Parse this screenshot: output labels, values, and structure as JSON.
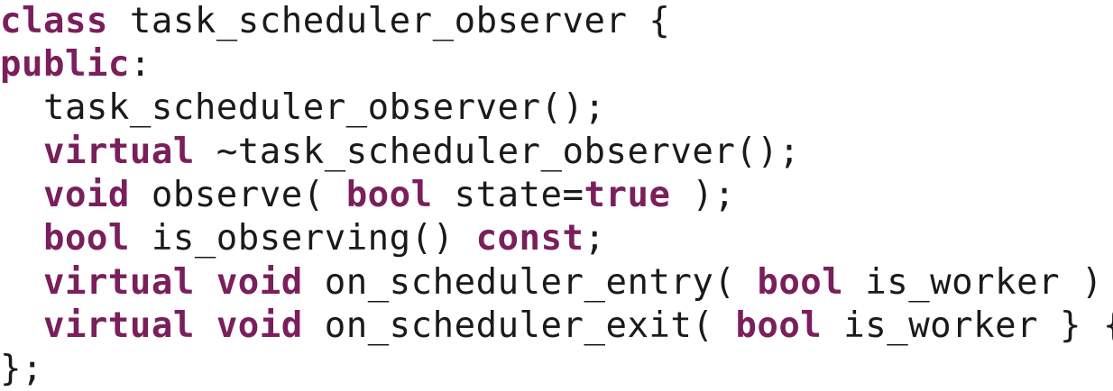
{
  "colors": {
    "keyword": "#7a1f5c",
    "text": "#1a1a1a",
    "background": "#ffffff"
  },
  "code": {
    "lines": [
      [
        {
          "t": "class",
          "k": "kw"
        },
        {
          "t": " task_scheduler_observer {",
          "k": "plain"
        }
      ],
      [
        {
          "t": "public",
          "k": "kw"
        },
        {
          "t": ":",
          "k": "plain"
        }
      ],
      [
        {
          "t": "  task_scheduler_observer();",
          "k": "plain"
        }
      ],
      [
        {
          "t": "  ",
          "k": "plain"
        },
        {
          "t": "virtual",
          "k": "kw"
        },
        {
          "t": " ~task_scheduler_observer();",
          "k": "plain"
        }
      ],
      [
        {
          "t": "  ",
          "k": "plain"
        },
        {
          "t": "void",
          "k": "kw"
        },
        {
          "t": " observe( ",
          "k": "plain"
        },
        {
          "t": "bool",
          "k": "kw"
        },
        {
          "t": " state=",
          "k": "plain"
        },
        {
          "t": "true",
          "k": "kw"
        },
        {
          "t": " );",
          "k": "plain"
        }
      ],
      [
        {
          "t": "  ",
          "k": "plain"
        },
        {
          "t": "bool",
          "k": "kw"
        },
        {
          "t": " is_observing() ",
          "k": "plain"
        },
        {
          "t": "const",
          "k": "kw"
        },
        {
          "t": ";",
          "k": "plain"
        }
      ],
      [
        {
          "t": "  ",
          "k": "plain"
        },
        {
          "t": "virtual",
          "k": "kw"
        },
        {
          "t": " ",
          "k": "plain"
        },
        {
          "t": "void",
          "k": "kw"
        },
        {
          "t": " on_scheduler_entry( ",
          "k": "plain"
        },
        {
          "t": "bool",
          "k": "kw"
        },
        {
          "t": " is_worker ) {}",
          "k": "plain"
        }
      ],
      [
        {
          "t": "  ",
          "k": "plain"
        },
        {
          "t": "virtual",
          "k": "kw"
        },
        {
          "t": " ",
          "k": "plain"
        },
        {
          "t": "void",
          "k": "kw"
        },
        {
          "t": " on_scheduler_exit( ",
          "k": "plain"
        },
        {
          "t": "bool",
          "k": "kw"
        },
        {
          "t": " is_worker } {}",
          "k": "plain"
        }
      ],
      [
        {
          "t": "};",
          "k": "plain"
        }
      ]
    ]
  }
}
